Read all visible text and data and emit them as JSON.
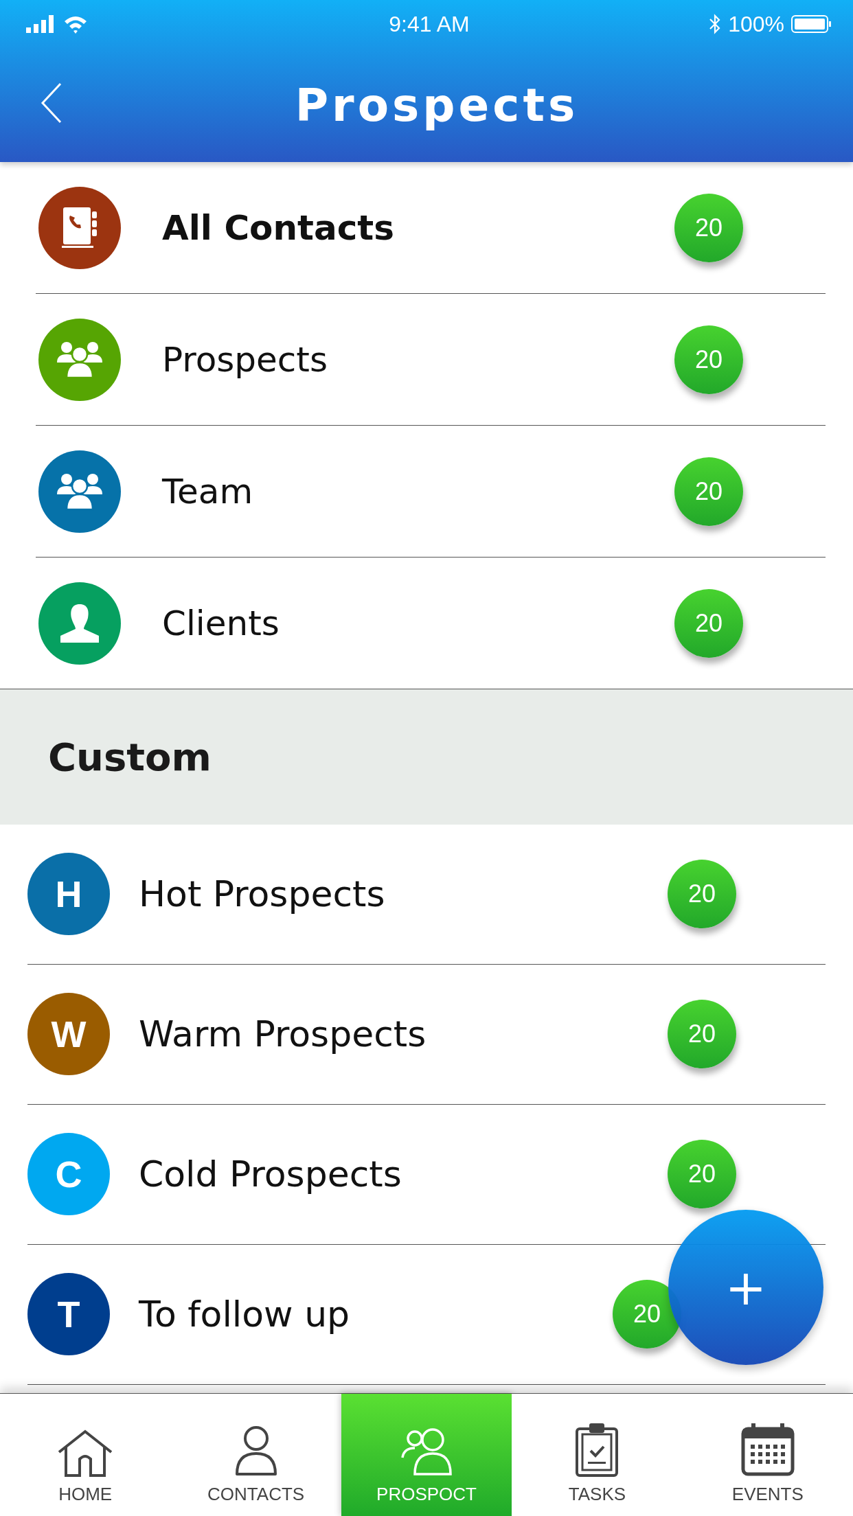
{
  "status_bar": {
    "time": "9:41 AM",
    "battery": "100%"
  },
  "header": {
    "title": "Prospects"
  },
  "groups": [
    {
      "label": "All Contacts",
      "count": "20",
      "color": "#9c3410",
      "selected": true
    },
    {
      "label": "Prospects",
      "count": "20",
      "color": "#56a503",
      "selected": false
    },
    {
      "label": "Team",
      "count": "20",
      "color": "#0672a9",
      "selected": false
    },
    {
      "label": "Clients",
      "count": "20",
      "color": "#06a060",
      "selected": false
    }
  ],
  "custom": {
    "title": "Custom",
    "items": [
      {
        "letter": "H",
        "label": "Hot Prospects",
        "count": "20",
        "color": "#0a6fa8"
      },
      {
        "letter": "W",
        "label": "Warm Prospects",
        "count": "20",
        "color": "#9a5c00"
      },
      {
        "letter": "C",
        "label": "Cold Prospects",
        "count": "20",
        "color": "#00a8f0"
      },
      {
        "letter": "T",
        "label": "To follow up",
        "count": "20",
        "color": "#003e8e"
      }
    ]
  },
  "fab": {
    "label": "+"
  },
  "tabs": [
    {
      "label": "HOME",
      "selected": false
    },
    {
      "label": "CONTACTS",
      "selected": false
    },
    {
      "label": "PROSPOCT",
      "selected": true
    },
    {
      "label": "TASKS",
      "selected": false
    },
    {
      "label": "EVENTS",
      "selected": false
    }
  ]
}
